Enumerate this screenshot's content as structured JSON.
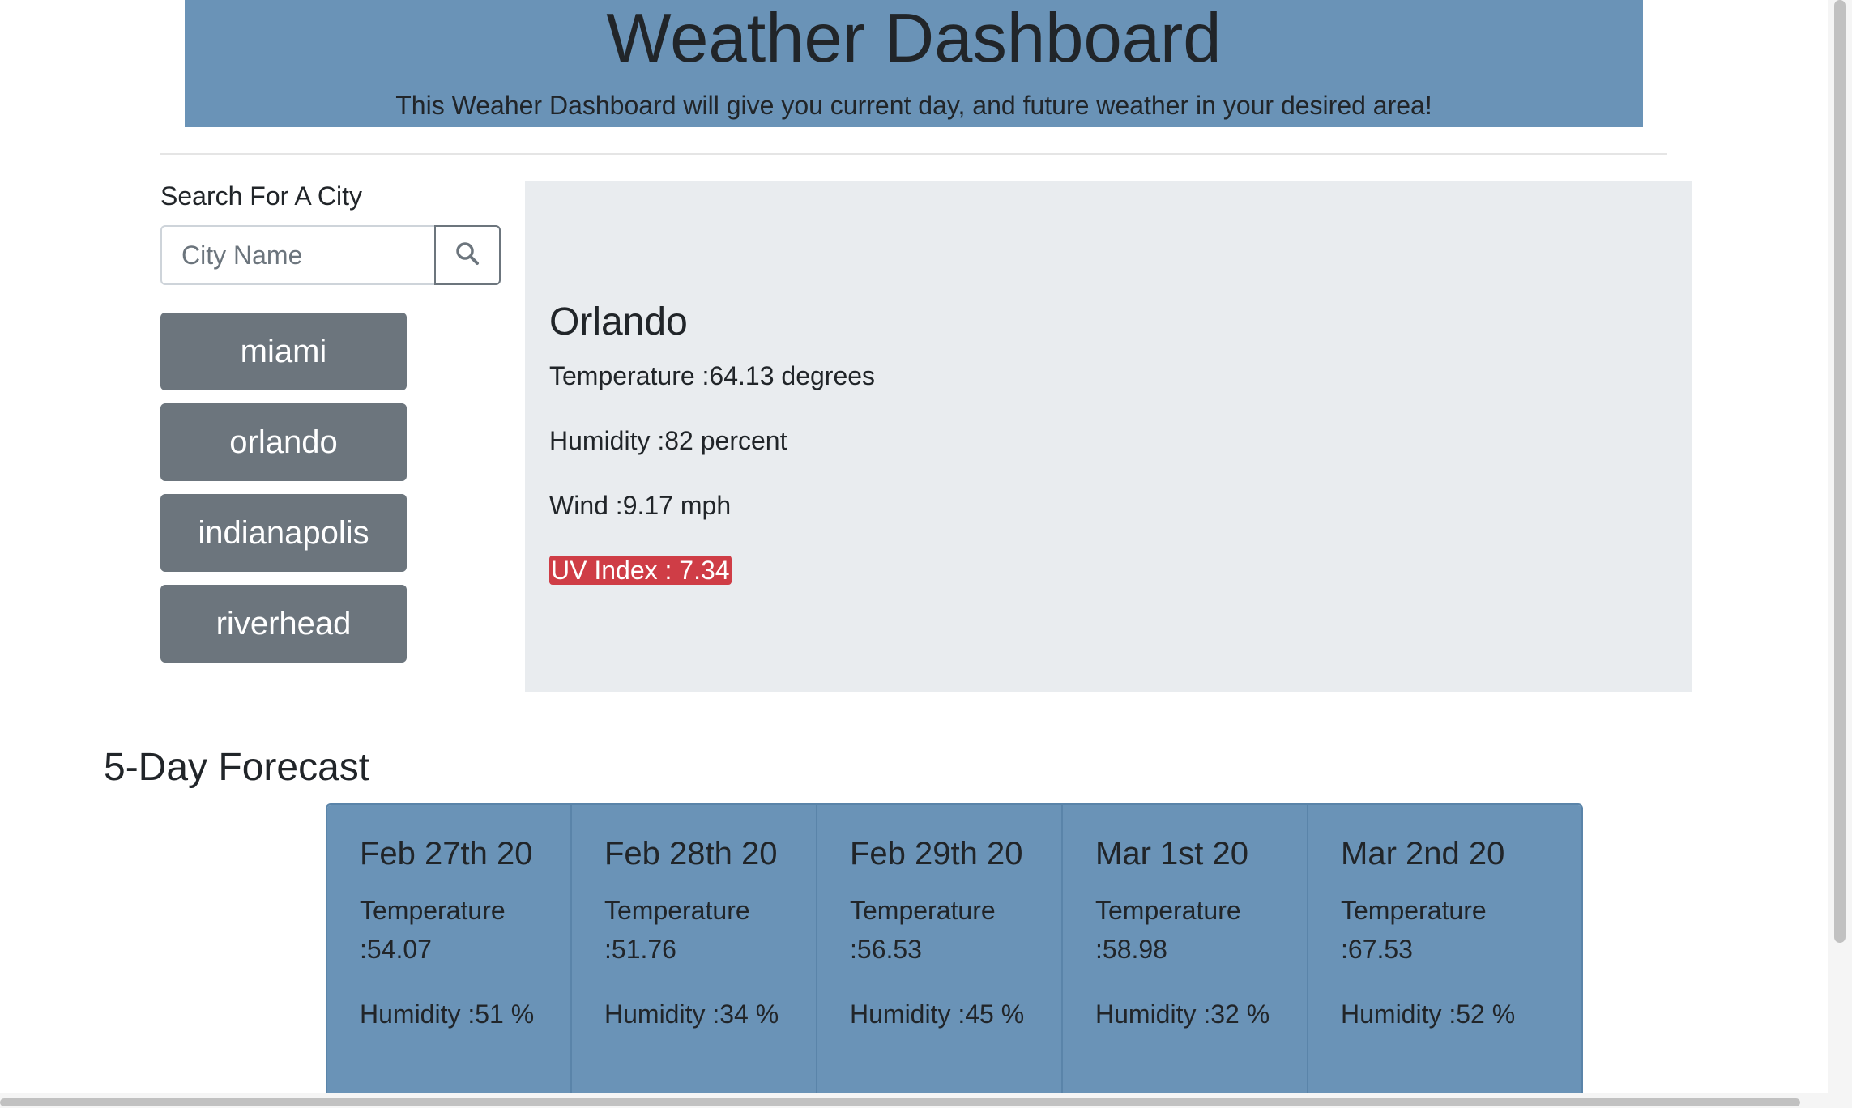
{
  "header": {
    "title": "Weather Dashboard",
    "subtitle": "This Weaher Dashboard will give you current day, and future weather in your desired area!"
  },
  "search": {
    "label": "Search For A City",
    "placeholder": "City Name",
    "button_icon": "search-icon"
  },
  "history": [
    {
      "label": "miami"
    },
    {
      "label": "orlando"
    },
    {
      "label": "indianapolis"
    },
    {
      "label": "riverhead"
    }
  ],
  "current": {
    "city": "Orlando",
    "temperature": "Temperature :64.13 degrees",
    "humidity": "Humidity :82 percent",
    "wind": "Wind :9.17 mph",
    "uv": "UV Index : 7.34",
    "uv_color": "#cf3d46"
  },
  "forecast": {
    "title": "5-Day Forecast",
    "days": [
      {
        "date": "Feb 27th 20",
        "temperature": "Temperature :54.07",
        "humidity": "Humidity :51 %"
      },
      {
        "date": "Feb 28th 20",
        "temperature": "Temperature :51.76",
        "humidity": "Humidity :34 %"
      },
      {
        "date": "Feb 29th 20",
        "temperature": "Temperature :56.53",
        "humidity": "Humidity :45 %"
      },
      {
        "date": "Mar 1st 20",
        "temperature": "Temperature :58.98",
        "humidity": "Humidity :32 %"
      },
      {
        "date": "Mar 2nd 20",
        "temperature": "Temperature :67.53",
        "humidity": "Humidity :52 %"
      }
    ]
  },
  "colors": {
    "header_bg": "#6a93b7",
    "panel_bg": "#e9ecef",
    "city_button_bg": "#6c757d",
    "forecast_card_bg": "#6a93b7"
  }
}
